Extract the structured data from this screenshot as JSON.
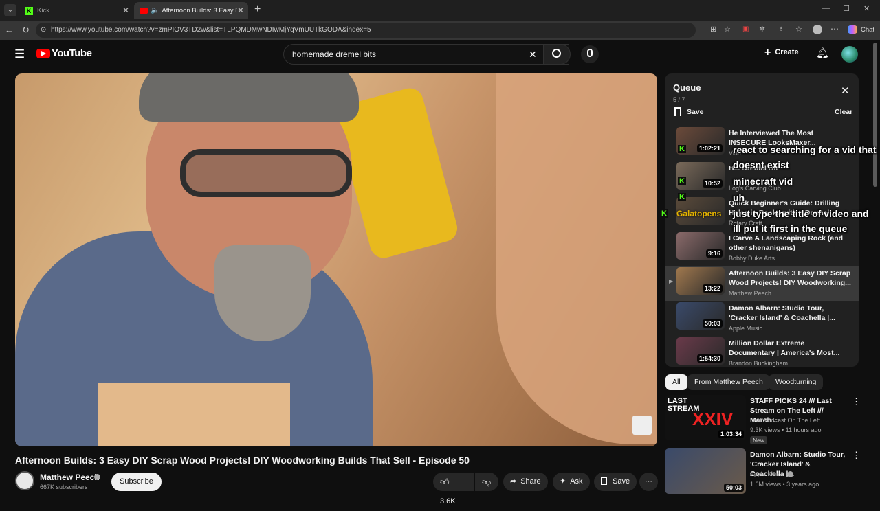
{
  "browser": {
    "tabs": [
      {
        "label": "Kick"
      },
      {
        "label": "Afternoon Builds: 3 Easy DIY S"
      }
    ],
    "url": "https://www.youtube.com/watch?v=zmPIOV3TD2w&list=TLPQMDMwNDIwMjYqVmUUTkGODA&index=5",
    "copilot_label": "Chat"
  },
  "header": {
    "logo_text": "YouTube",
    "search_value": "homemade dremel bits",
    "create_label": "Create"
  },
  "video": {
    "title": "Afternoon Builds: 3 Easy DIY Scrap Wood Projects! DIY Woodworking Builds That Sell - Episode 50",
    "channel": "Matthew Peech",
    "subscribers": "667K subscribers",
    "subscribe_label": "Subscribe",
    "likes": "3.6K",
    "share_label": "Share",
    "ask_label": "Ask",
    "save_label": "Save"
  },
  "queue": {
    "title": "Queue",
    "position": "5 / 7",
    "save_label": "Save",
    "clear_label": "Clear",
    "items": [
      {
        "title": "He Interviewed The Most INSECURE LooksMaxer...",
        "channel": "Vidu...",
        "duration": "1:02:21",
        "thumb_color": "#6b4a3a"
      },
      {
        "title": "H... Dremel Bit",
        "channel": "Log's Carving Club",
        "duration": "10:52",
        "thumb_color": "#7a6a5a"
      },
      {
        "title": "Quick Beginner's Guide: Drilling Holes in Rocks with a Dremel!",
        "channel": "Rotary Craft",
        "duration": "",
        "thumb_color": "#5a4a3a"
      },
      {
        "title": "I Carve A Landscaping Rock (and other shenanigans)",
        "channel": "Bobby Duke Arts",
        "duration": "9:16",
        "thumb_color": "#8a6a6a"
      },
      {
        "title": "Afternoon Builds: 3 Easy DIY Scrap Wood Projects! DIY Woodworking...",
        "channel": "Matthew Peech",
        "duration": "13:22",
        "thumb_color": "#a0784e"
      },
      {
        "title": "Damon Albarn: Studio Tour, 'Cracker Island' & Coachella |...",
        "channel": "Apple Music",
        "duration": "50:03",
        "thumb_color": "#3a4a6a"
      },
      {
        "title": "Million Dollar Extreme Documentary | America's Most...",
        "channel": "Brandon Buckingham",
        "duration": "1:54:30",
        "thumb_color": "#6a3a4a"
      }
    ]
  },
  "chips": [
    {
      "label": "All"
    },
    {
      "label": "From Matthew Peech"
    },
    {
      "label": "Woodturning"
    }
  ],
  "recommendations": [
    {
      "title": "STAFF PICKS 24 /// Last Stream on The Left /// March ...",
      "channel": "Last Podcast On The Left",
      "meta": "9.3K views • 11 hours ago",
      "badge": "New",
      "duration": "1:03:34",
      "thumb_text": "XXIV",
      "thumb_color": "#1a1a1a"
    },
    {
      "title": "Damon Albarn: Studio Tour, 'Cracker Island' & Coachella |...",
      "channel": "Apple Music",
      "meta": "1.6M views • 3 years ago",
      "badge": "",
      "duration": "50:03",
      "thumb_text": "",
      "thumb_color": "#3a4a6a"
    }
  ],
  "chat_overlay": [
    {
      "user": "",
      "message": "react to searching for a vid that",
      "color": "#53fc18"
    },
    {
      "user": "",
      "message": "doesnt exist",
      "color": "#53fc18"
    },
    {
      "user": "",
      "message": "minecraft vid",
      "color": "#ff4d4d"
    },
    {
      "user": "",
      "message": "uh",
      "color": "#ff4d4d"
    },
    {
      "user": "Galatopens",
      "message": "just type the title of video and",
      "color": "#e5b400"
    },
    {
      "user": "",
      "message": "ill put it first in the queue",
      "color": "#e5b400"
    }
  ]
}
